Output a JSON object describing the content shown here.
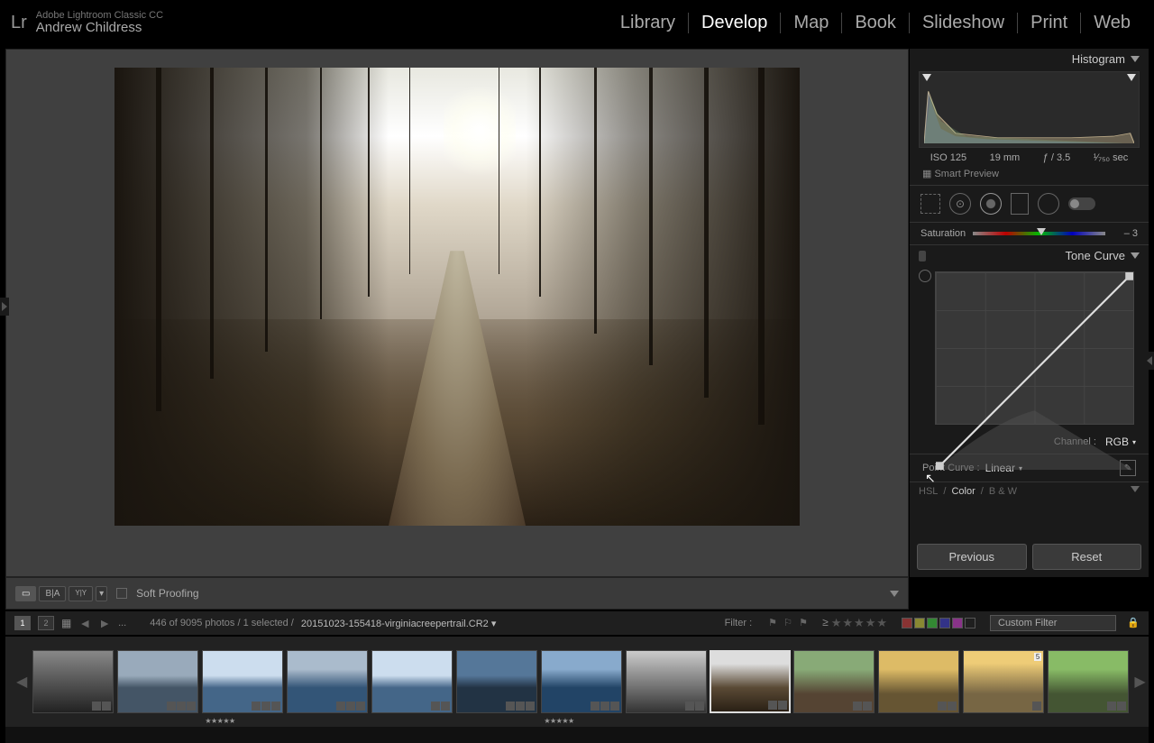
{
  "app": {
    "title": "Adobe Lightroom Classic CC",
    "user": "Andrew Childress",
    "logo": "Lr"
  },
  "modules": [
    "Library",
    "Develop",
    "Map",
    "Book",
    "Slideshow",
    "Print",
    "Web"
  ],
  "active_module": "Develop",
  "right": {
    "histogram_label": "Histogram",
    "exif": {
      "iso": "ISO 125",
      "focal": "19 mm",
      "aperture": "ƒ / 3.5",
      "shutter": "¹⁄₇₅₀ sec"
    },
    "smart_preview": "Smart Preview",
    "saturation": {
      "label": "Saturation",
      "value": "– 3"
    },
    "tone_curve_label": "Tone Curve",
    "channel_label": "Channel :",
    "channel_value": "RGB",
    "point_curve_label": "Point Curve :",
    "point_curve_value": "Linear",
    "extra_panels": [
      "HSL",
      "Color",
      "B & W"
    ],
    "prev_btn": "Previous",
    "reset_btn": "Reset"
  },
  "under_toolbar": {
    "soft_proof": "Soft Proofing"
  },
  "filter_bar": {
    "crumb_prefix": "...",
    "count_text": "446 of 9095 photos / 1 selected /",
    "filename": "20151023-155418-virginiacreepertrail.CR2",
    "filter_label": "Filter :",
    "filter_dropdown": "Custom Filter"
  },
  "thumb_flag": "5"
}
